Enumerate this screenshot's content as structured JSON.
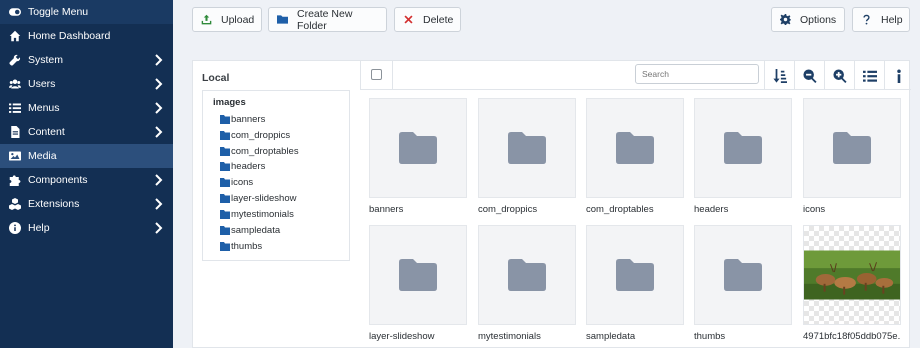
{
  "sidebar": {
    "items": [
      {
        "label": "Toggle Menu",
        "icon": "toggle-icon",
        "chevron": false
      },
      {
        "label": "Home Dashboard",
        "icon": "home-icon",
        "chevron": false
      },
      {
        "label": "System",
        "icon": "wrench-icon",
        "chevron": true
      },
      {
        "label": "Users",
        "icon": "users-icon",
        "chevron": true
      },
      {
        "label": "Menus",
        "icon": "list-icon",
        "chevron": true
      },
      {
        "label": "Content",
        "icon": "file-icon",
        "chevron": true
      },
      {
        "label": "Media",
        "icon": "image-icon",
        "chevron": false,
        "active": true
      },
      {
        "label": "Components",
        "icon": "puzzle-icon",
        "chevron": true
      },
      {
        "label": "Extensions",
        "icon": "cubes-icon",
        "chevron": true
      },
      {
        "label": "Help",
        "icon": "info-icon",
        "chevron": true
      }
    ]
  },
  "toolbar": {
    "upload": "Upload",
    "create_folder": "Create New Folder",
    "delete": "Delete",
    "options": "Options",
    "help": "Help"
  },
  "tree": {
    "title": "Local",
    "root": "images",
    "folders": [
      "banners",
      "com_droppics",
      "com_droptables",
      "headers",
      "icons",
      "layer-slideshow",
      "mytestimonials",
      "sampledata",
      "thumbs"
    ]
  },
  "content": {
    "search_placeholder": "Search",
    "items": [
      {
        "name": "banners",
        "type": "folder"
      },
      {
        "name": "com_droppics",
        "type": "folder"
      },
      {
        "name": "com_droptables",
        "type": "folder"
      },
      {
        "name": "headers",
        "type": "folder"
      },
      {
        "name": "icons",
        "type": "folder"
      },
      {
        "name": "layer-slideshow",
        "type": "folder"
      },
      {
        "name": "mytestimonials",
        "type": "folder"
      },
      {
        "name": "sampledata",
        "type": "folder"
      },
      {
        "name": "thumbs",
        "type": "folder"
      },
      {
        "name": "4971bfc18f05ddb075e...",
        "type": "image"
      }
    ]
  },
  "colors": {
    "sidebar": "#132f53",
    "sidebar_active": "#2c4f7c",
    "folder_icon": "#8994a6",
    "tree_folder": "#1e5fa8"
  }
}
